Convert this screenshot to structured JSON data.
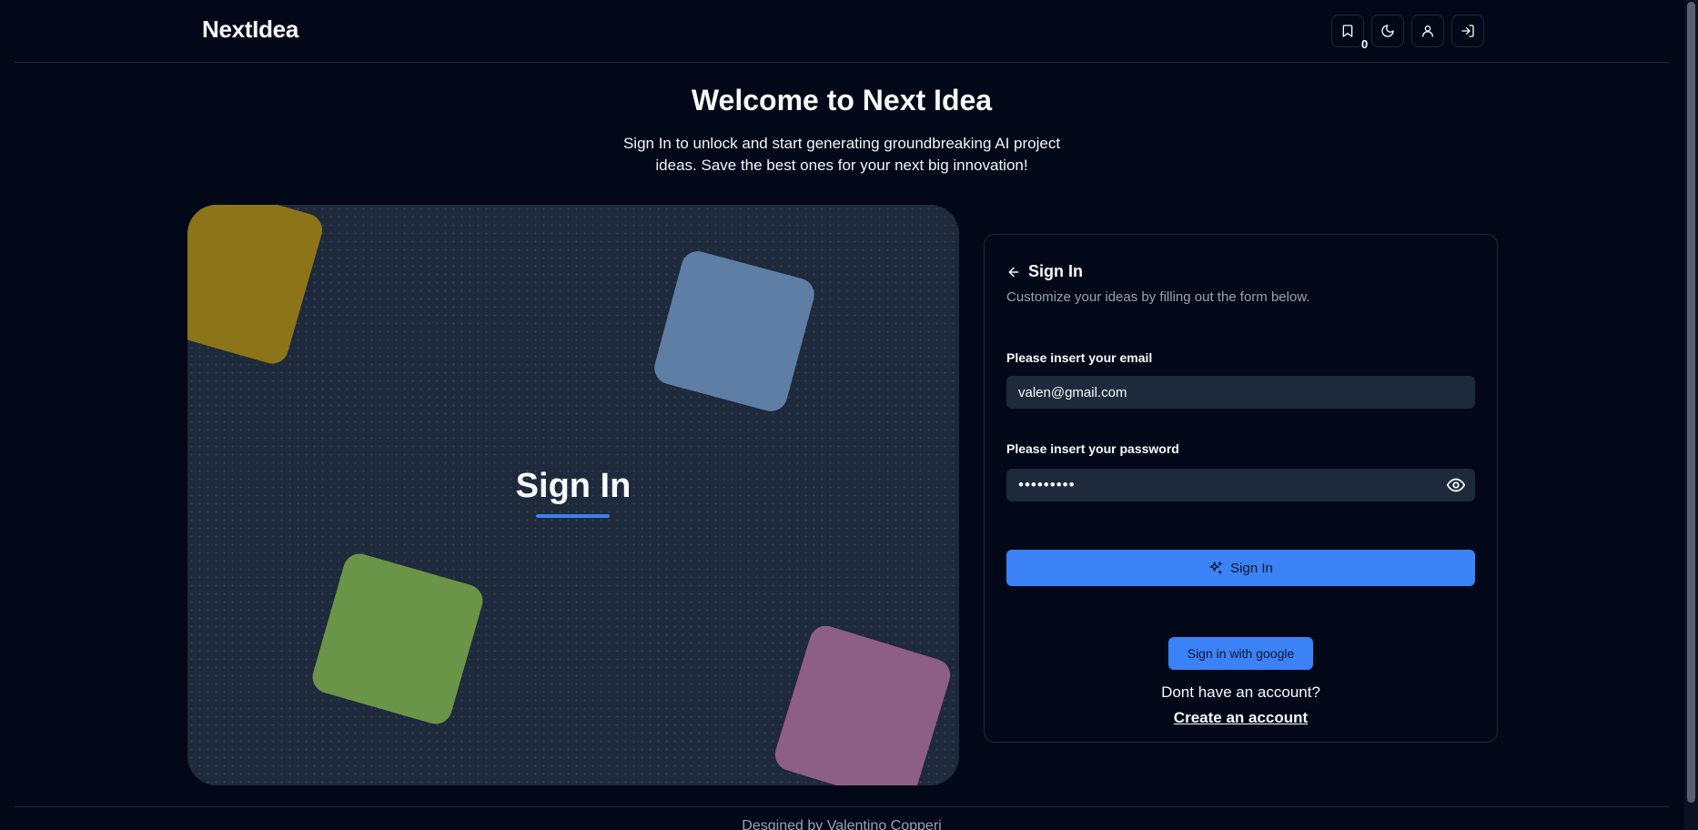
{
  "header": {
    "brand": "NextIdea",
    "saved_count": "0",
    "buttons": [
      {
        "icon": "bookmark-icon"
      },
      {
        "icon": "moon-icon"
      },
      {
        "icon": "user-icon"
      },
      {
        "icon": "log-in-icon"
      }
    ]
  },
  "hero": {
    "title": "Welcome to Next Idea",
    "subtitle": "Sign In to unlock and start generating groundbreaking AI project ideas. Save the best ones for your next big innovation!"
  },
  "art_panel": {
    "title": "Sign In"
  },
  "form": {
    "title": "Sign In",
    "description": "Customize your ideas by filling out the form below.",
    "email_label": "Please insert your email",
    "email_value": "valen@gmail.com",
    "password_label": "Please insert your password",
    "password_value": "•••••••••",
    "submit_label": "Sign In",
    "google_label": "Sign in with google",
    "no_account_text": "Dont have an account?",
    "create_account_label": "Create an account"
  },
  "footer": {
    "text": "Desgined by Valentino Copperi"
  },
  "colors": {
    "background": "#020817",
    "accent": "#3b82f6",
    "panel": "#1e293b",
    "tile_yellow": "#8c7419",
    "tile_blue": "#5f7ea6",
    "tile_green": "#6a9447",
    "tile_pink": "#8e5f84"
  }
}
